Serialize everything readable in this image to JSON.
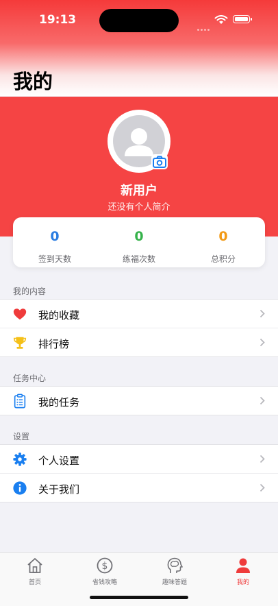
{
  "status_bar": {
    "time": "19:13"
  },
  "page_title": "我的",
  "profile": {
    "name": "新用户",
    "bio": "还没有个人简介"
  },
  "stats": [
    {
      "value": "0",
      "label": "签到天数",
      "color": "#2a7de1"
    },
    {
      "value": "0",
      "label": "练福次数",
      "color": "#35b24a"
    },
    {
      "value": "0",
      "label": "总积分",
      "color": "#f29a16"
    }
  ],
  "sections": [
    {
      "title": "我的内容",
      "items": [
        {
          "label": "我的收藏",
          "icon": "heart-icon"
        },
        {
          "label": "排行榜",
          "icon": "trophy-icon"
        }
      ]
    },
    {
      "title": "任务中心",
      "items": [
        {
          "label": "我的任务",
          "icon": "clipboard-icon"
        }
      ]
    },
    {
      "title": "设置",
      "items": [
        {
          "label": "个人设置",
          "icon": "gear-icon"
        },
        {
          "label": "关于我们",
          "icon": "info-icon"
        }
      ]
    }
  ],
  "tabs": [
    {
      "label": "首页",
      "icon": "home-icon",
      "active": false
    },
    {
      "label": "省钱攻略",
      "icon": "dollar-icon",
      "active": false
    },
    {
      "label": "趣味答题",
      "icon": "brain-icon",
      "active": false
    },
    {
      "label": "我的",
      "icon": "person-icon",
      "active": true
    }
  ],
  "colors": {
    "accent": "#f54444",
    "tab_active": "#ef3b3b",
    "link_blue": "#1a7ff0"
  }
}
